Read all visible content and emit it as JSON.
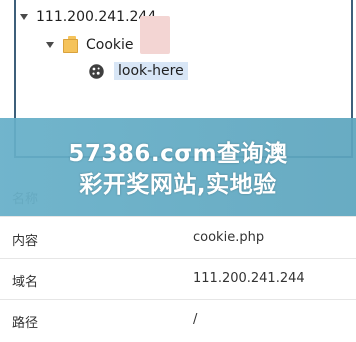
{
  "tree": {
    "host": "111.200.241.244",
    "folder": "Cookie",
    "cookie_name": "look-here"
  },
  "banner": {
    "line1": "57386.cσm查询澳",
    "line2": "彩开奖网站,实地验"
  },
  "properties": {
    "header_key": "名称",
    "rows": [
      {
        "key": "内容",
        "value": "cookie.php"
      },
      {
        "key": "域名",
        "value": "111.200.241.244"
      },
      {
        "key": "路径",
        "value": "/"
      }
    ]
  },
  "colors": {
    "panel_border": "#3d5f7a",
    "selection": "#d8e6f6",
    "banner": "#66afc8",
    "folder": "#f5c35b"
  }
}
